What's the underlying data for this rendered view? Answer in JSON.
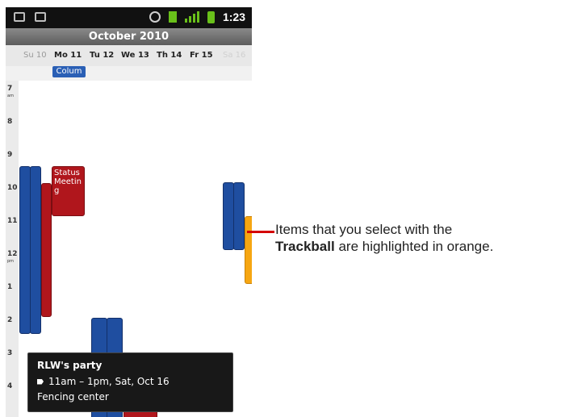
{
  "status_bar": {
    "time": "1:23",
    "icons": [
      "gmail-icon",
      "sdcard-icon",
      "gps-icon",
      "usb-debug-icon",
      "signal-icon",
      "battery-icon"
    ]
  },
  "calendar": {
    "month_title": "October 2010",
    "days": [
      {
        "label": "Su 10",
        "state": "dim"
      },
      {
        "label": "Mo 11",
        "state": "normal"
      },
      {
        "label": "Tu 12",
        "state": "normal"
      },
      {
        "label": "We 13",
        "state": "normal"
      },
      {
        "label": "Th 14",
        "state": "normal"
      },
      {
        "label": "Fr 15",
        "state": "normal"
      },
      {
        "label": "Sa 16",
        "state": "dimmer"
      }
    ],
    "all_day_event": "Colum",
    "hours": [
      {
        "label": "7",
        "suffix": "am"
      },
      {
        "label": "8",
        "suffix": ""
      },
      {
        "label": "9",
        "suffix": ""
      },
      {
        "label": "10",
        "suffix": ""
      },
      {
        "label": "11",
        "suffix": ""
      },
      {
        "label": "12",
        "suffix": "pm"
      },
      {
        "label": "1",
        "suffix": ""
      },
      {
        "label": "2",
        "suffix": ""
      },
      {
        "label": "3",
        "suffix": ""
      },
      {
        "label": "4",
        "suffix": ""
      }
    ],
    "events": [
      {
        "color": "blue"
      },
      {
        "color": "blue"
      },
      {
        "color": "red"
      },
      {
        "color": "red",
        "label": "Status Meeting"
      },
      {
        "color": "blue"
      },
      {
        "color": "blue"
      },
      {
        "color": "red"
      },
      {
        "color": "blue"
      },
      {
        "color": "blue"
      },
      {
        "color": "orange",
        "selected": true
      }
    ],
    "colors": {
      "blue": "#1f4ea0",
      "red": "#b0161c",
      "orange": "#f6a612"
    }
  },
  "popup": {
    "title": "RLW's party",
    "time": "11am – 1pm, Sat, Oct 16",
    "location": "Fencing center"
  },
  "callout": {
    "line1": "Items that you select with the",
    "bold": "Trackball",
    "rest": "are highlighted in orange."
  }
}
